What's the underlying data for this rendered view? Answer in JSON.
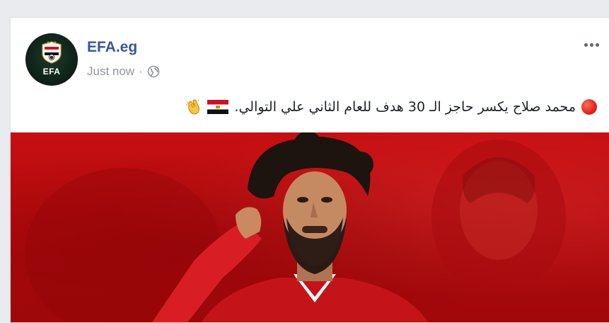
{
  "post": {
    "page_name": "EFA.eg",
    "timestamp": "Just now",
    "separator": "·",
    "privacy_icon": "globe-icon",
    "more_icon": "ellipsis-icon",
    "avatar": {
      "label": "EFA",
      "icon": "efa-crest-icon"
    },
    "text": "محمد صلاح يكسر حاجز الـ 30 هدف للعام الثاني علي التوالي.",
    "emojis": [
      "red-circle-icon",
      "egypt-flag-icon",
      "clapping-hands-icon"
    ],
    "image": {
      "subject": "player-celebration-photo"
    }
  },
  "colors": {
    "page_name": "#365899",
    "meta_text": "#90949c",
    "body_text": "#1d2129",
    "photo_red": "#c80f12"
  }
}
